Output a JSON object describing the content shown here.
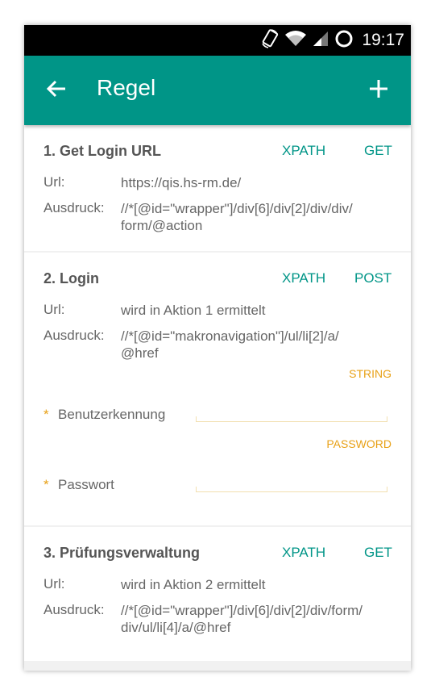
{
  "status_bar": {
    "time": "19:17",
    "icons": [
      "rotation-icon",
      "wifi-icon",
      "signal-icon",
      "loading-icon"
    ]
  },
  "app_bar": {
    "title": "Regel",
    "back_icon": "arrow-left-icon",
    "add_icon": "plus-icon"
  },
  "colors": {
    "primary": "#009587",
    "accent": "#e8a117",
    "text": "#666666"
  },
  "rules": [
    {
      "title": "1. Get Login URL",
      "type": "XPATH",
      "method": "GET",
      "url_label": "Url:",
      "url": "https://qis.hs-rm.de/",
      "expr_label": "Ausdruck:",
      "expr_line1": "//*[@id=\"wrapper\"]/div[6]/div[2]/div/div/",
      "expr_line2": "form/@action"
    },
    {
      "title": "2. Login",
      "type": "XPATH",
      "method": "POST",
      "url_label": "Url:",
      "url": "wird in Aktion 1 ermittelt",
      "expr_label": "Ausdruck:",
      "expr_line1": "//*[@id=\"makronavigation\"]/ul/li[2]/a/",
      "expr_line2": "@href",
      "fields": [
        {
          "type": "STRING",
          "required_mark": "*",
          "label": "Benutzerkennung",
          "value": ""
        },
        {
          "type": "PASSWORD",
          "required_mark": "*",
          "label": "Passwort",
          "value": ""
        }
      ]
    },
    {
      "title": "3. Prüfungsverwaltung",
      "type": "XPATH",
      "method": "GET",
      "url_label": "Url:",
      "url": "wird in Aktion 2 ermittelt",
      "expr_label": "Ausdruck:",
      "expr_line1": "//*[@id=\"wrapper\"]/div[6]/div[2]/div/form/",
      "expr_line2": "div/ul/li[4]/a/@href"
    }
  ]
}
